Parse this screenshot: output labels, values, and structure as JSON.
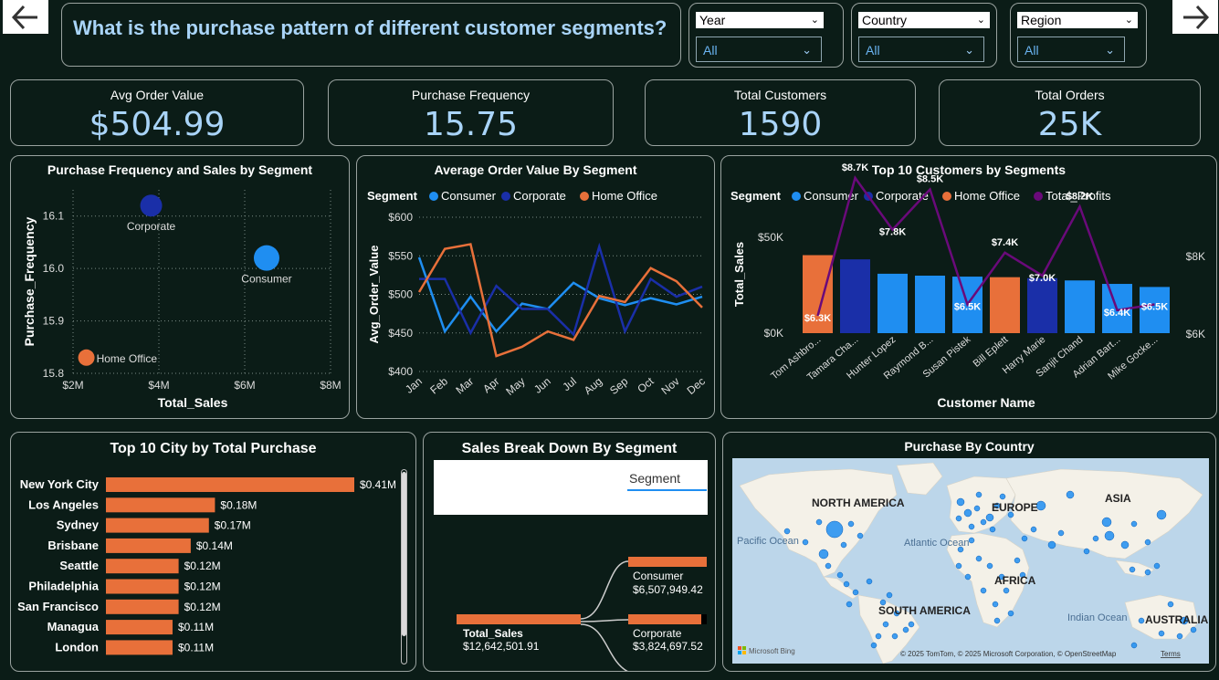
{
  "header": {
    "title": "What is the purchase pattern of different customer segments?"
  },
  "filters": [
    {
      "label": "Year",
      "value": "All"
    },
    {
      "label": "Country",
      "value": "All"
    },
    {
      "label": "Region",
      "value": "All"
    }
  ],
  "kpis": [
    {
      "label": "Avg Order Value",
      "value": "$504.99"
    },
    {
      "label": "Purchase Frequency",
      "value": "15.75"
    },
    {
      "label": "Total Customers",
      "value": "1590"
    },
    {
      "label": "Total Orders",
      "value": "25K"
    }
  ],
  "colors": {
    "consumer": "#1f8ef1",
    "corporate": "#1a2fa8",
    "home_office": "#e8703a",
    "profits": "#6a0a7a",
    "bar": "#e8703a",
    "title": "#a9d4f8"
  },
  "chart_data": [
    {
      "type": "scatter",
      "title": "Purchase Frequency and Sales by Segment",
      "xlabel": "Total_Sales",
      "ylabel": "Purchase_Frequency",
      "xticks": [
        "$2M",
        "$4M",
        "$6M",
        "$8M"
      ],
      "yticks": [
        "15.8",
        "15.9",
        "16.0",
        "16.1"
      ],
      "xlim": [
        2,
        8
      ],
      "ylim": [
        15.8,
        16.15
      ],
      "points": [
        {
          "name": "Corporate",
          "x": 3.82,
          "y": 16.12
        },
        {
          "name": "Consumer",
          "x": 6.51,
          "y": 16.02
        },
        {
          "name": "Home Office",
          "x": 2.31,
          "y": 15.83
        }
      ]
    },
    {
      "type": "line",
      "title": "Average Order Value By Segment",
      "legend_title": "Segment",
      "xlabel": "",
      "ylabel": "Avg_Order_Value",
      "categories": [
        "Jan",
        "Feb",
        "Mar",
        "Apr",
        "May",
        "Jun",
        "Jul",
        "Aug",
        "Sep",
        "Oct",
        "Nov",
        "Dec"
      ],
      "yticks": [
        "$400",
        "$450",
        "$500",
        "$550",
        "$600"
      ],
      "ylim": [
        400,
        600
      ],
      "series": [
        {
          "name": "Consumer",
          "values": [
            548,
            452,
            497,
            452,
            488,
            481,
            515,
            495,
            486,
            495,
            487,
            497
          ]
        },
        {
          "name": "Corporate",
          "values": [
            520,
            520,
            450,
            511,
            481,
            481,
            448,
            562,
            452,
            520,
            497,
            510
          ]
        },
        {
          "name": "Home Office",
          "values": [
            503,
            559,
            565,
            420,
            432,
            452,
            441,
            498,
            490,
            534,
            517,
            483
          ]
        }
      ]
    },
    {
      "type": "bar",
      "title": "Top 10 Customers by Segments",
      "legend_title": "Segment",
      "xlabel": "Customer Name",
      "ylabel": "Total_Sales",
      "categories": [
        "Tom Ashbro...",
        "Tamara Cha...",
        "Hunter Lopez",
        "Raymond B...",
        "Susan Pistek",
        "Bill Eplett",
        "Harry Marie",
        "Sanjit Chand",
        "Adrian Bart...",
        "Mike Gocke..."
      ],
      "values": [
        40700,
        38500,
        31000,
        30000,
        29500,
        29200,
        28700,
        27500,
        25700,
        24100
      ],
      "segments": [
        "Home Office",
        "Corporate",
        "Consumer",
        "Consumer",
        "Consumer",
        "Home Office",
        "Corporate",
        "Consumer",
        "Consumer",
        "Consumer"
      ],
      "yticks_left": [
        "$0K",
        "$50K"
      ],
      "yticks_right": [
        "$6K",
        "$8K"
      ],
      "ylim": [
        0,
        50000
      ],
      "profit_series": {
        "name": "Total_Profits",
        "values": [
          6.3,
          8.7,
          7.8,
          8.5,
          6.5,
          7.4,
          7.0,
          8.2,
          6.4,
          6.5
        ],
        "ylim": [
          6,
          8
        ]
      },
      "profit_labels": [
        "$6.3K",
        "$8.7K",
        "$7.8K",
        "$8.5K",
        "$6.5K",
        "$7.4K",
        "$7.0K",
        "$8.2K",
        "$6.4K",
        "$6.5K"
      ]
    },
    {
      "type": "bar",
      "title": "Top 10 City by Total Purchase",
      "categories": [
        "New York City",
        "Los Angeles",
        "Sydney",
        "Brisbane",
        "Seattle",
        "Philadelphia",
        "San Francisco",
        "Managua",
        "London"
      ],
      "values": [
        0.41,
        0.18,
        0.17,
        0.14,
        0.12,
        0.12,
        0.12,
        0.11,
        0.11
      ],
      "labels": [
        "$0.41M",
        "$0.18M",
        "$0.17M",
        "$0.14M",
        "$0.12M",
        "$0.12M",
        "$0.12M",
        "$0.11M",
        "$0.11M"
      ]
    }
  ],
  "decomposition": {
    "title": "Sales Break Down By Segment",
    "field": "Segment",
    "root": {
      "label": "Total_Sales",
      "value": "$12,642,501.91"
    },
    "children": [
      {
        "label": "Consumer",
        "value": "$6,507,949.42"
      },
      {
        "label": "Corporate",
        "value": "$3,824,697.52"
      }
    ]
  },
  "map": {
    "title": "Purchase By Country",
    "continents": [
      "NORTH AMERICA",
      "EUROPE",
      "ASIA",
      "AFRICA",
      "SOUTH AMERICA",
      "AUSTRALIA"
    ],
    "oceans": [
      "Pacific Ocean",
      "Atlantic Ocean",
      "Indian Ocean"
    ],
    "brand": "Microsoft Bing",
    "attribution": "© 2025 TomTom, © 2025 Microsoft Corporation, © OpenStreetMap",
    "terms": "Terms"
  }
}
